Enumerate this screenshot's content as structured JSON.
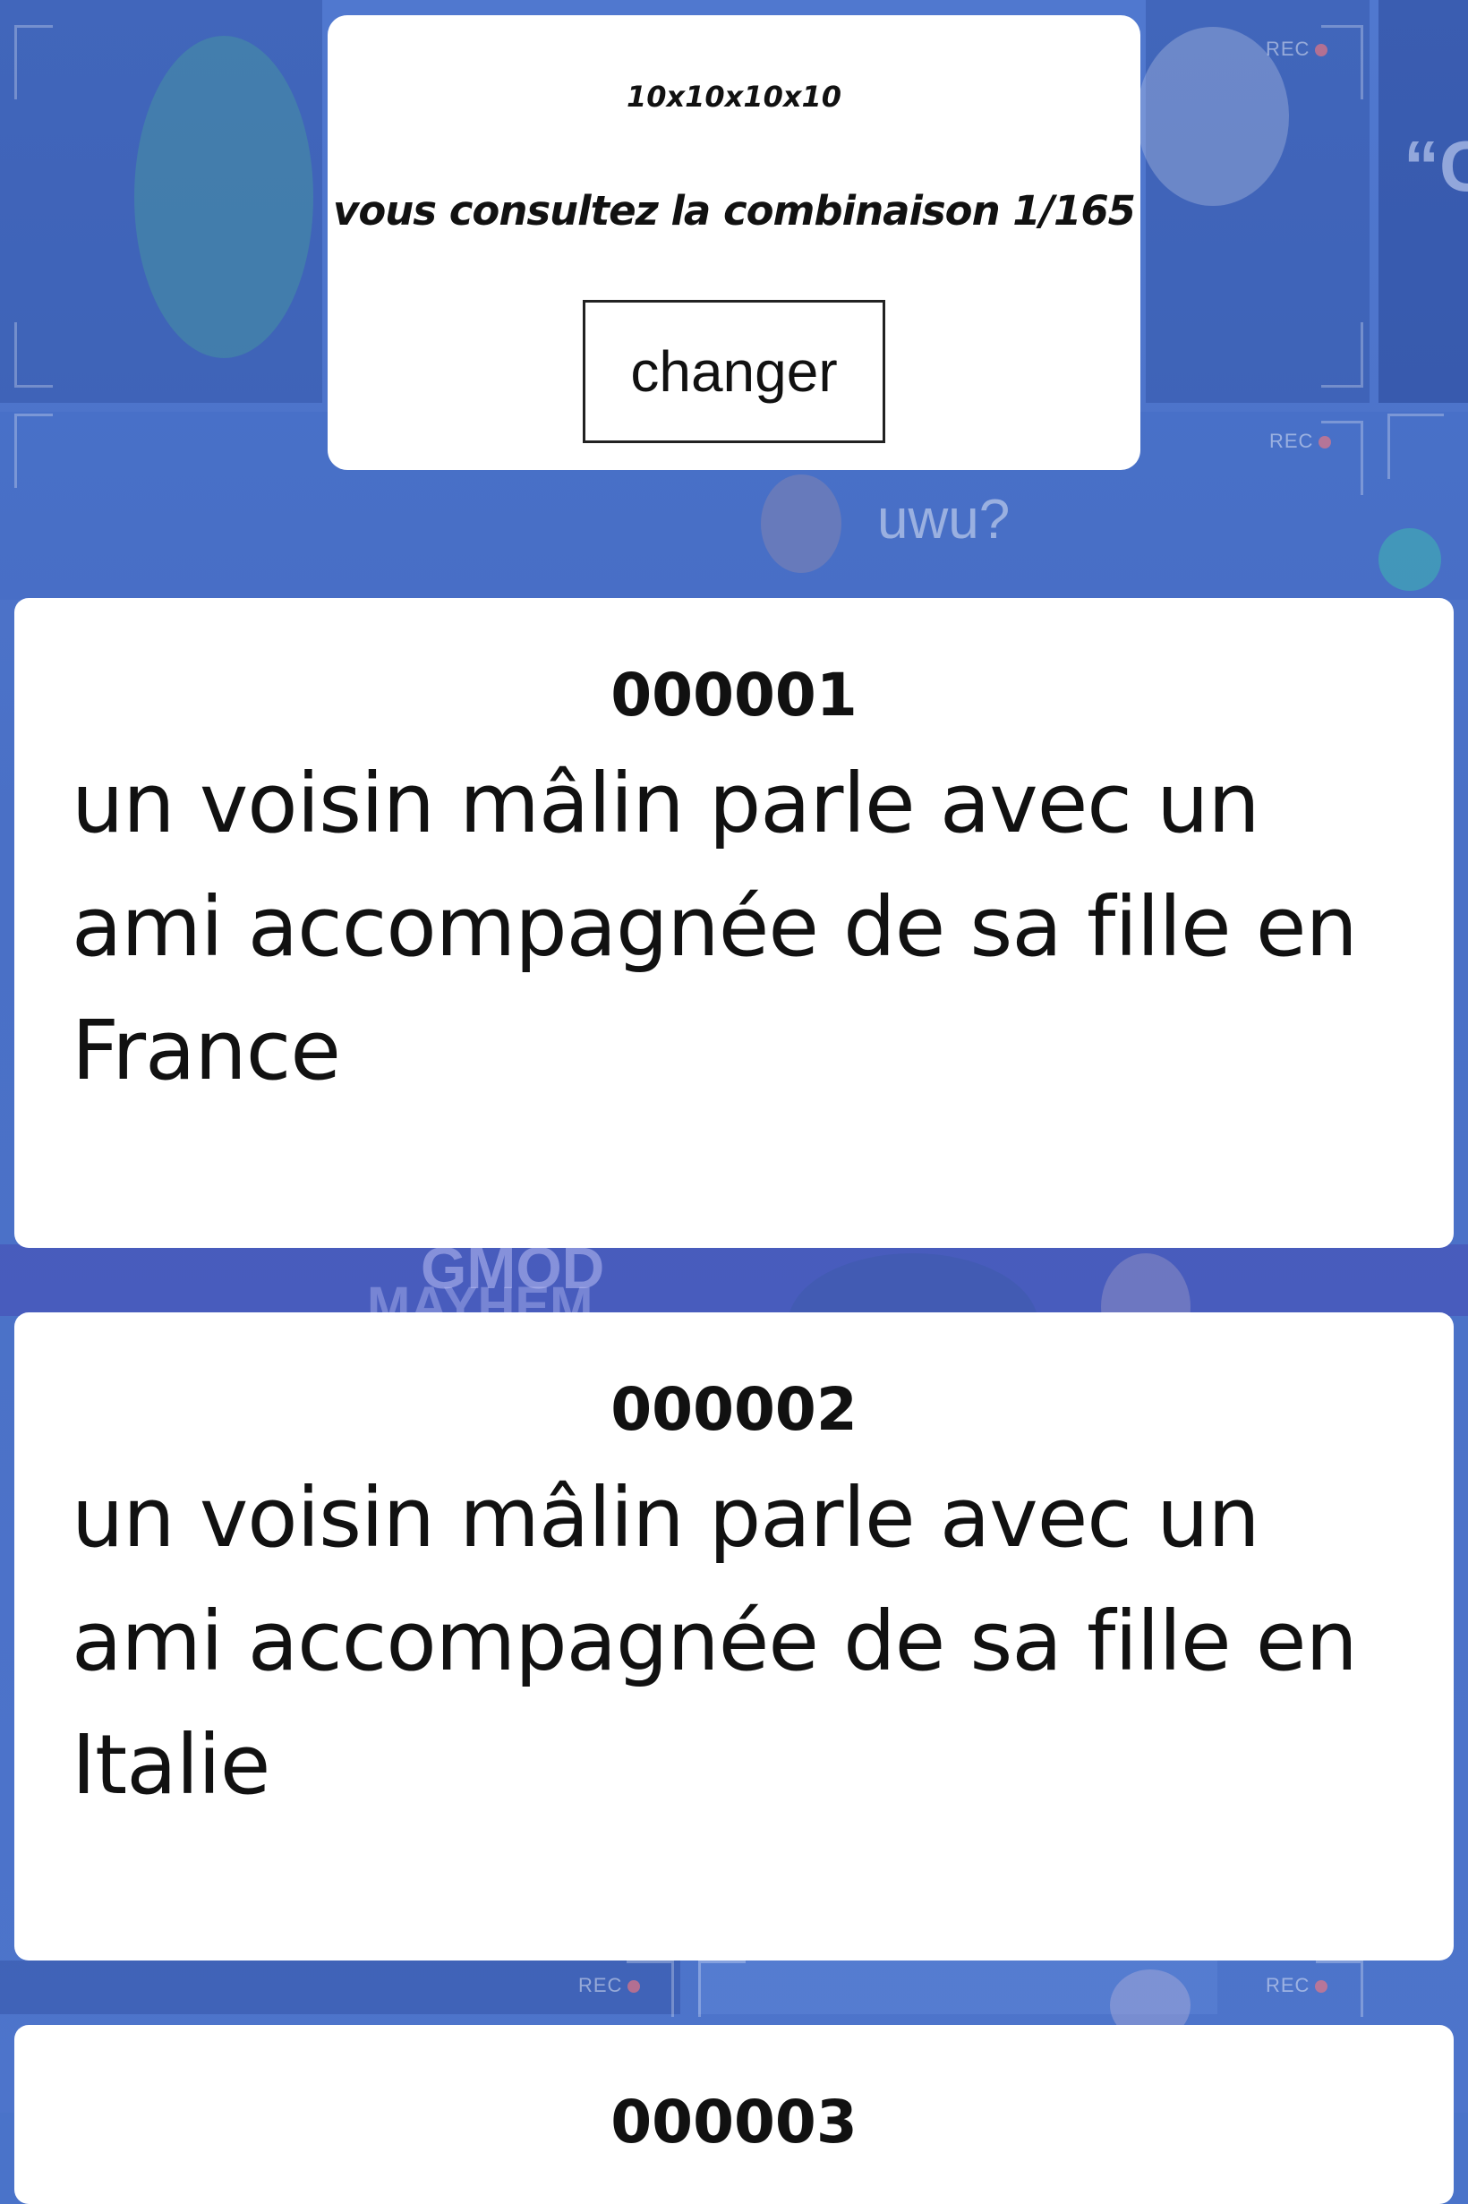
{
  "header": {
    "dimensions": "10x10x10x10",
    "status": "vous consultez la combinaison 1/165",
    "change_label": "changer"
  },
  "cards": [
    {
      "id": "000001",
      "text": "un voisin mâlin parle avec un ami accompagnée de sa fille en France"
    },
    {
      "id": "000002",
      "text": "un voisin mâlin parle avec un ami accompagnée de sa fille en Italie"
    },
    {
      "id": "000003",
      "text": ""
    }
  ],
  "background": {
    "rec_label": "REC",
    "caption_uwu": "uwu?",
    "caption_gmod": "GMOD",
    "caption_mayhem": "MAYHEM",
    "caption_quote": "“C",
    "color": "#4a73c9"
  }
}
